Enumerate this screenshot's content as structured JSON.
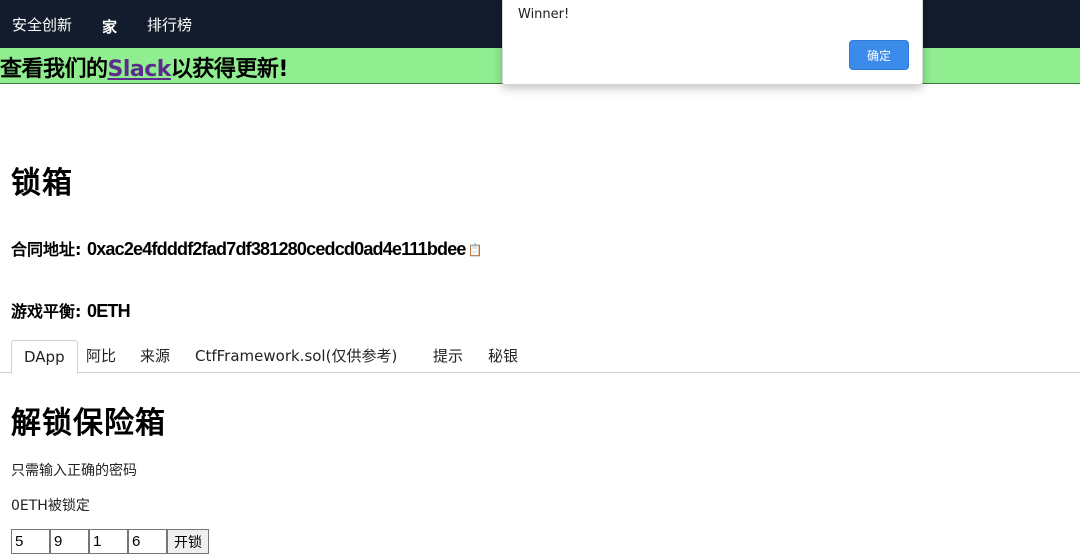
{
  "nav": {
    "brand": "安全创新",
    "home": "家",
    "leaderboard": "排行榜"
  },
  "banner": {
    "prefix": "查看我们的",
    "link": "Slack",
    "suffix": "以获得更新!"
  },
  "alert": {
    "message": "Winner!",
    "ok_label": "确定"
  },
  "page": {
    "title": "锁箱",
    "contract_label": "合同地址:",
    "contract_address": "0xac2e4fdddf2fad7df381280cedcd0ad4e111bdee",
    "balance_label": "游戏平衡:",
    "balance_value": "0ETH"
  },
  "tabs": [
    {
      "label": "DApp",
      "active": true
    },
    {
      "label": "阿比"
    },
    {
      "label": "来源"
    },
    {
      "label": "CtfFramework.sol(仅供参考)"
    },
    {
      "label": "提示"
    },
    {
      "label": "秘银"
    }
  ],
  "dapp": {
    "heading": "解锁保险箱",
    "description": "只需输入正确的密码",
    "locked_text": "0ETH被锁定",
    "digits": [
      "5",
      "9",
      "1",
      "6"
    ],
    "unlock_label": "开锁"
  }
}
